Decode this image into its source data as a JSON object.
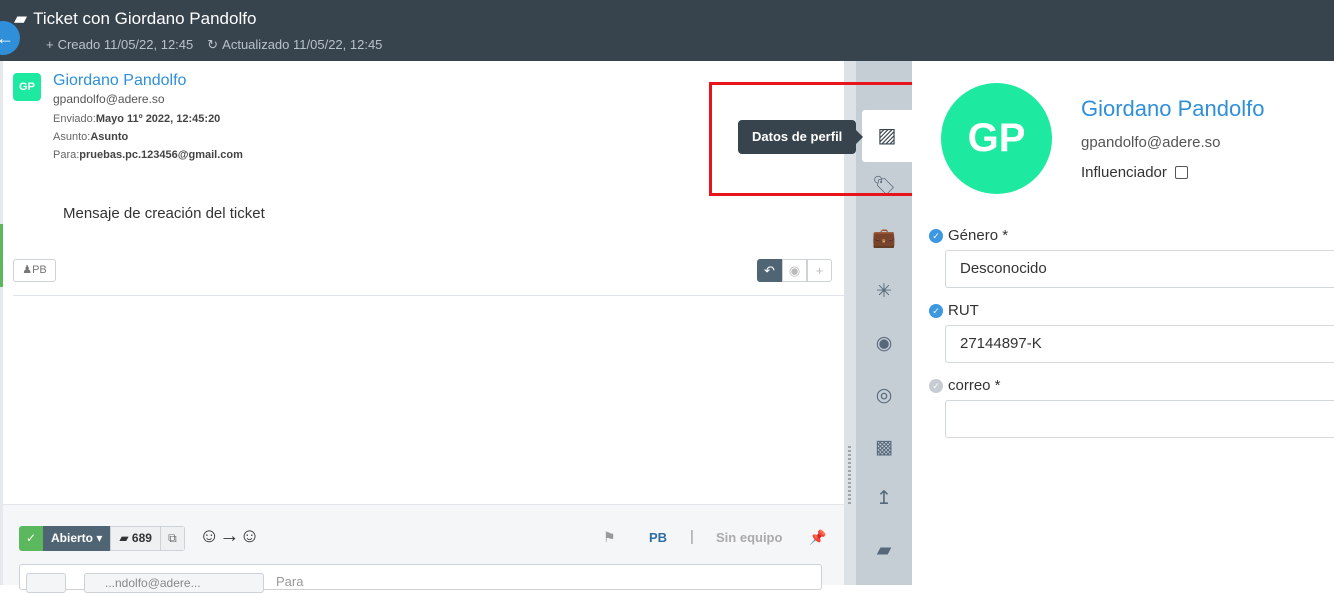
{
  "header": {
    "title": "Ticket con Giordano Pandolfo",
    "created_label": "Creado",
    "created_value": "11/05/22, 12:45",
    "updated_label": "Actualizado",
    "updated_value": "11/05/22, 12:45"
  },
  "message": {
    "avatar_initials": "GP",
    "sender_name": "Giordano Pandolfo",
    "sender_email": "gpandolfo@adere.so",
    "sent_label": "Enviado:",
    "sent_value": "Mayo 11º 2022, 12:45:20",
    "subject_label": "Asunto:",
    "subject_value": "Asunto",
    "to_label": "Para:",
    "to_value": "pruebas.pc.123456@gmail.com",
    "body": "Mensaje de creación del ticket",
    "author_chip": "PB"
  },
  "footer": {
    "status": "Abierto",
    "ticket_number": "689",
    "assignee": "PB",
    "separator": "|",
    "team": "Sin equipo",
    "compose_from": "...ndolfo@adere...",
    "compose_to_placeholder": "Para"
  },
  "sidebar": {
    "tooltip": "Datos de perfil",
    "icons": [
      "profile-card-icon",
      "tag-icon",
      "briefcase-icon",
      "network-icon",
      "comment-icon",
      "comments-icon",
      "puzzle-icon",
      "share-icon",
      "ticket-icon"
    ]
  },
  "profile": {
    "avatar_initials": "GP",
    "name": "Giordano Pandolfo",
    "email": "gpandolfo@adere.so",
    "influencer_label": "Influenciador",
    "fields": [
      {
        "label": "Género *",
        "value": "Desconocido"
      },
      {
        "label": "RUT",
        "value": "27144897-K"
      },
      {
        "label": "correo *",
        "value": ""
      }
    ]
  },
  "colors": {
    "header_bg": "#37434d",
    "accent_blue": "#2f8fd8",
    "avatar_green": "#1de9a1",
    "highlight_red": "#e8141c",
    "status_green": "#5cb85c"
  }
}
